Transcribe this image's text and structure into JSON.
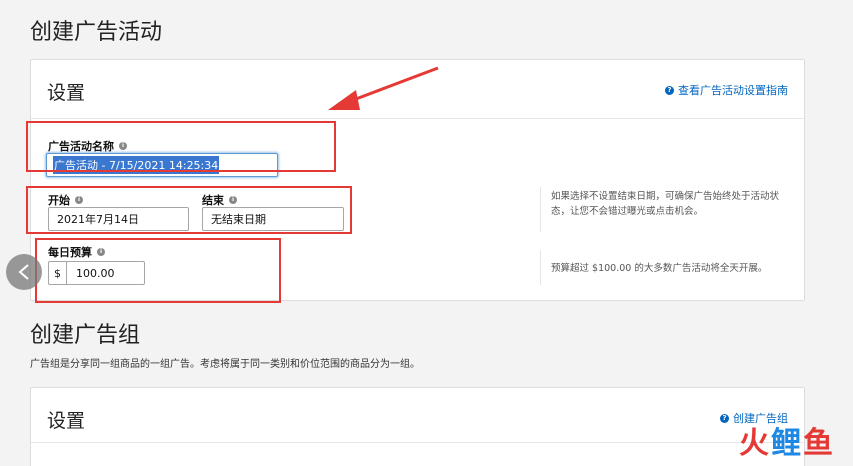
{
  "page": {
    "title": "创建广告活动"
  },
  "settings_card": {
    "title": "设置",
    "help_link": "查看广告活动设置指南",
    "campaign_name": {
      "label": "广告活动名称",
      "value": "广告活动 - 7/15/2021 14:25:34"
    },
    "start": {
      "label": "开始",
      "value": "2021年7月14日"
    },
    "end": {
      "label": "结束",
      "value": "无结束日期"
    },
    "date_hint": "如果选择不设置结束日期，可确保广告始终处于活动状态，让您不会错过曝光或点击机会。",
    "daily_budget": {
      "label": "每日预算",
      "currency": "$",
      "value": "100.00"
    },
    "budget_hint": "预算超过 $100.00 的大多数广告活动将全天开展。"
  },
  "ad_group_section": {
    "title": "创建广告组",
    "description": "广告组是分享同一组商品的一组广告。考虑将属于同一类别和价位范围的商品分为一组。",
    "card_title": "设置",
    "create_link": "创建广告组"
  },
  "watermark": {
    "chars": [
      "火",
      "鲤",
      "鱼"
    ]
  },
  "colors": {
    "link": "#0066c0",
    "annotation_red": "#e53935",
    "selection": "#3a77d1"
  }
}
